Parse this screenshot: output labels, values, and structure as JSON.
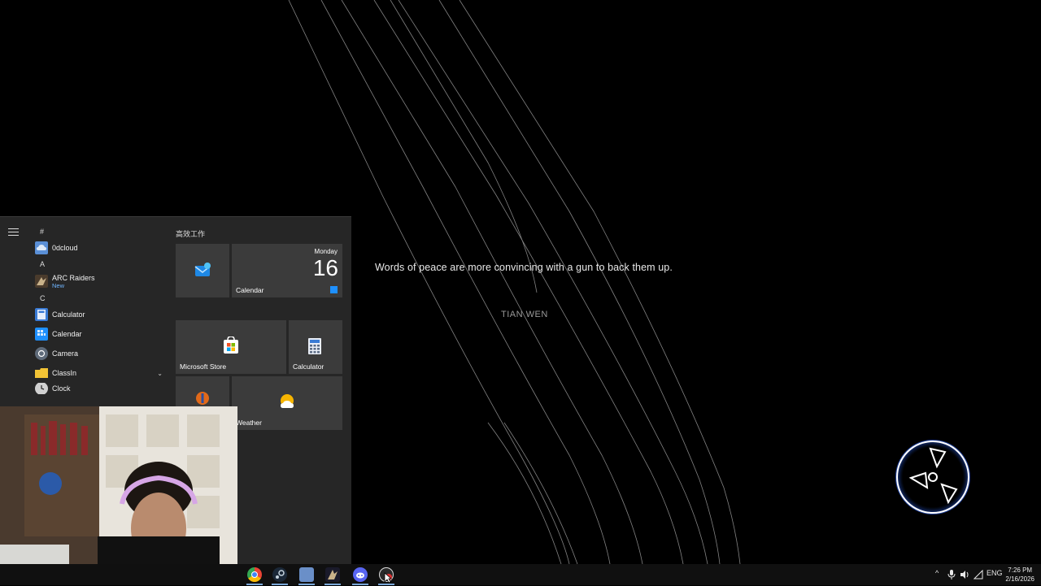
{
  "background": {
    "quote": "Words of peace are more convincing with a gun to back them up.",
    "author": "TIAN WEN",
    "logo_icon": "arc-raiders-logo-icon"
  },
  "start_menu": {
    "menu_icon": "hamburger-menu-icon",
    "apps": [
      {
        "type": "letter",
        "label": "#"
      },
      {
        "type": "app",
        "label": "0dcloud",
        "icon": "cloud-app-icon",
        "color": "#5a8fd6"
      },
      {
        "type": "letter",
        "label": "A"
      },
      {
        "type": "app",
        "label": "ARC Raiders",
        "sub": "New",
        "icon": "arc-raiders-icon",
        "color": "#8a6d4a"
      },
      {
        "type": "letter",
        "label": "C"
      },
      {
        "type": "app",
        "label": "Calculator",
        "icon": "calculator-icon",
        "color": "#3a7bd5"
      },
      {
        "type": "app",
        "label": "Calendar",
        "icon": "calendar-icon",
        "color": "#1e90ff"
      },
      {
        "type": "app",
        "label": "Camera",
        "icon": "camera-icon",
        "color": "#5f6b7a"
      },
      {
        "type": "app",
        "label": "ClassIn",
        "icon": "folder-icon",
        "color": "#f2c335",
        "chevron": true
      },
      {
        "type": "app",
        "label": "Clock",
        "icon": "clock-icon",
        "color": "#d0d0d0"
      }
    ],
    "tile_group_title": "高效工作",
    "tiles": {
      "mail_icon": "mail-icon",
      "calendar": {
        "label": "Calendar",
        "day": "Monday",
        "date": "16"
      },
      "store": {
        "label": "Microsoft Store",
        "icon": "store-icon"
      },
      "calculator": {
        "label": "Calculator",
        "icon": "calculator-icon"
      },
      "weather": {
        "label": "Weather",
        "icon": "weather-icon"
      },
      "partial_icon": "app-icon"
    }
  },
  "taskbar": {
    "icons": [
      "chrome-icon",
      "steam-icon",
      "0dcloud-icon",
      "arc-raiders-icon",
      "discord-icon",
      "obs-icon"
    ],
    "tray": {
      "language": "ENG",
      "time": "7:26 PM",
      "date": "2/16/2026"
    }
  }
}
